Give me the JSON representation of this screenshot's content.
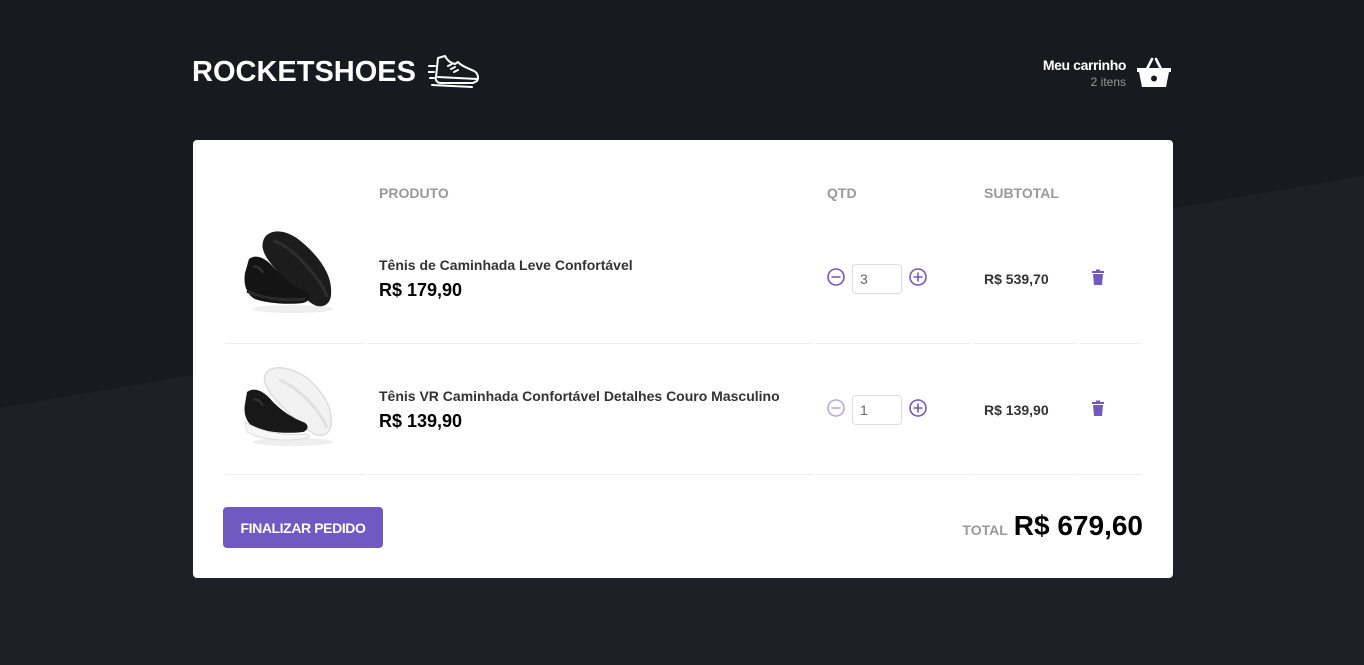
{
  "brand": {
    "name": "ROCKETSHOES"
  },
  "cart": {
    "title": "Meu carrinho",
    "count": "2 itens"
  },
  "table": {
    "headers": {
      "product": "PRODUTO",
      "qty": "QTD",
      "subtotal": "SUBTOTAL"
    },
    "items": [
      {
        "title": "Tênis de Caminhada Leve Confortável",
        "price": "R$ 179,90",
        "quantity": "3",
        "subtotal": "R$ 539,70",
        "decrement_enabled": true,
        "shoe_color": "black"
      },
      {
        "title": "Tênis VR Caminhada Confortável Detalhes Couro Masculino",
        "price": "R$ 139,90",
        "quantity": "1",
        "subtotal": "R$ 139,90",
        "decrement_enabled": false,
        "shoe_color": "black-white-sole"
      }
    ]
  },
  "footer": {
    "checkout_label": "FINALIZAR PEDIDO",
    "total_label": "TOTAL",
    "total_value": "R$ 679,60"
  },
  "icons": {
    "logo": "running-shoe-icon",
    "cart": "shopping-basket-icon",
    "decrement": "minus-circle-icon",
    "increment": "plus-circle-icon",
    "delete": "trash-icon"
  },
  "colors": {
    "background": "#191920",
    "accent": "#7159c1",
    "accent_disabled": "#b6aadd",
    "panel": "#ffffff"
  }
}
